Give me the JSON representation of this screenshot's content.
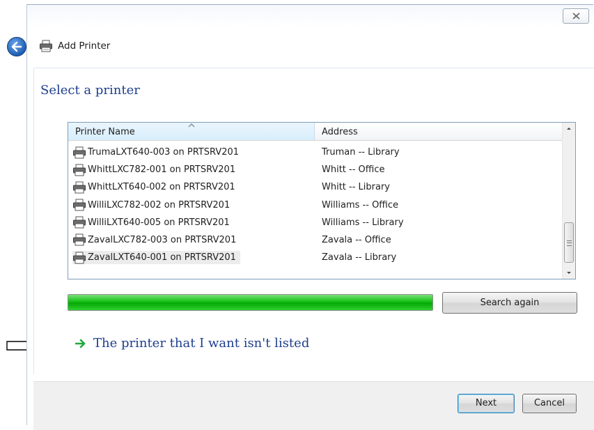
{
  "window": {
    "title": "Add Printer",
    "close_glyph": "✕"
  },
  "page": {
    "heading": "Select a printer"
  },
  "list": {
    "columns": [
      "Printer Name",
      "Address"
    ],
    "rows": [
      {
        "name": "TrumaLXT640-003 on PRTSRV201",
        "address": "Truman -- Library"
      },
      {
        "name": "WhittLXC782-001 on PRTSRV201",
        "address": "Whitt -- Office"
      },
      {
        "name": "WhittLXT640-002 on PRTSRV201",
        "address": "Whitt -- Library"
      },
      {
        "name": "WilliLXC782-002 on PRTSRV201",
        "address": "Williams -- Office"
      },
      {
        "name": "WilliLXT640-005 on PRTSRV201",
        "address": "Williams -- Library"
      },
      {
        "name": "ZavalLXC782-003 on PRTSRV201",
        "address": "Zavala -- Office"
      },
      {
        "name": "ZavalLXT640-001 on PRTSRV201",
        "address": "Zavala -- Library"
      }
    ],
    "selected_index": 6
  },
  "search": {
    "progress_percent": 100,
    "button_label": "Search again"
  },
  "link": {
    "label": "The printer that I want isn't listed"
  },
  "footer": {
    "next_label": "Next",
    "cancel_label": "Cancel"
  },
  "colors": {
    "heading": "#1e3e8e",
    "progress": "#13c013",
    "link_arrow": "#1faa3c"
  },
  "icons": {
    "back": "back-arrow-icon",
    "printer": "printer-icon",
    "link": "green-arrow-icon",
    "callout": "outline-arrow-icon"
  }
}
